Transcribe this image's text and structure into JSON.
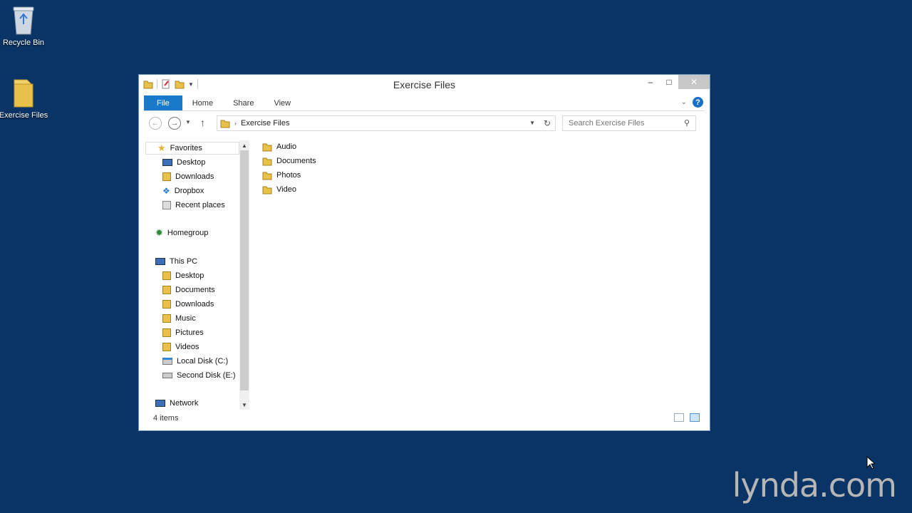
{
  "desktop": {
    "icons": [
      {
        "label": "Recycle Bin"
      },
      {
        "label": "Exercise Files"
      }
    ]
  },
  "window": {
    "title": "Exercise Files",
    "ribbon_tabs": [
      "File",
      "Home",
      "Share",
      "View"
    ],
    "address_path": "Exercise Files",
    "search_placeholder": "Search Exercise Files"
  },
  "navigation_pane": {
    "favorites_label": "Favorites",
    "favorites": [
      "Desktop",
      "Downloads",
      "Dropbox",
      "Recent places"
    ],
    "homegroup_label": "Homegroup",
    "thispc_label": "This PC",
    "thispc_items": [
      "Desktop",
      "Documents",
      "Downloads",
      "Music",
      "Pictures",
      "Videos",
      "Local Disk (C:)",
      "Second Disk (E:)"
    ],
    "network_label": "Network"
  },
  "content": {
    "items": [
      "Audio",
      "Documents",
      "Photos",
      "Video"
    ]
  },
  "status_bar": {
    "item_count": "4 items"
  },
  "watermark": "lynda.com",
  "colors": {
    "desktop_bg": "#0a3466",
    "file_tab": "#1979ca",
    "folder_yellow": "#e8c14a"
  }
}
